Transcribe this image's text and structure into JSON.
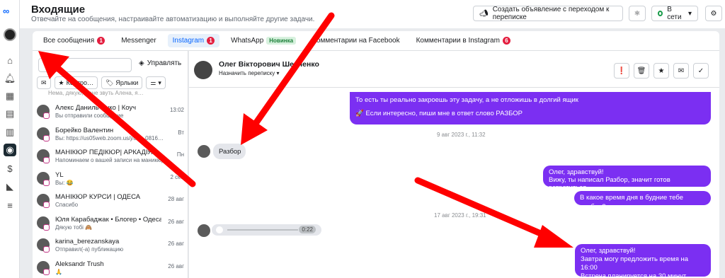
{
  "header": {
    "title": "Входящие",
    "subtitle": "Отвечайте на сообщения, настраивайте автоматизацию и выполняйте другие задачи.",
    "ad_button": "Создать объявление с переходом к переписке",
    "status_label": "В сети"
  },
  "tabs": [
    {
      "label": "Все сообщения",
      "badge": "1"
    },
    {
      "label": "Messenger",
      "badge": ""
    },
    {
      "label": "Instagram",
      "badge": "1"
    },
    {
      "label": "WhatsApp",
      "badge": "",
      "tag": "Новинка"
    },
    {
      "label": "Комментарии на Facebook",
      "badge": ""
    },
    {
      "label": "Комментарии в Instagram",
      "badge": "6"
    }
  ],
  "list": {
    "manage_label": "Управлять",
    "filters": [
      "Контро…",
      "Ярлыки"
    ],
    "clipped_preview": "Нема, дякую, мене звуть Алена, я…",
    "conversations": [
      {
        "name": "Алекс Данильченко | Коуч",
        "preview": "Вы отправили сообщение",
        "time": "13:02"
      },
      {
        "name": "Борейко Валентин",
        "preview": "Вы: https://us05web.zoom.us/j/85…0816…",
        "time": "Вт"
      },
      {
        "name": "МАНІКЮР ПЕДІКЮР| АРКАДІЯ",
        "preview": "Напоминаем о вашей записи на маникюр…",
        "time": "Пн"
      },
      {
        "name": "YL",
        "preview": "Вы: 😂",
        "time": "2 сен"
      },
      {
        "name": "МАНІКЮР КУРСИ | ОДЕСА",
        "preview": "Спасибо",
        "time": "28 авг"
      },
      {
        "name": "Юля Карабаджак • Блогер • Одеса",
        "preview": "Дякую тобі 🙈",
        "time": "26 авг"
      },
      {
        "name": "karina_berezanskaya",
        "preview": "Отправил(-а) публикацию",
        "time": "26 авг"
      },
      {
        "name": "Aleksandr Trush",
        "preview": "🙏",
        "time": "26 авг"
      }
    ]
  },
  "chat": {
    "contact_name": "Олег Вікторович Шевченко",
    "assign_label": "Назначить переписку ▾",
    "messages": {
      "m1_line1": "То есть ты реально закроешь эту задачу, а не отложишь в долгий ящик",
      "m1_line2": "🚀 Если интересно, пиши мне в ответ слово РАЗБОР",
      "ts1": "9 авг 2023 г., 11:32",
      "m2": "Разбор",
      "m3_line1": "Олег, здравствуй!",
      "m3_line2": "Вижу, ты написал Разбор, значит готов встретиться",
      "m4": "В какое время дня в будние тебе удобно?",
      "ts2": "17 авг 2023 г., 19:31",
      "audio_duration": "0:22",
      "m5_line1": "Олег, здравствуй!",
      "m5_line2": "Завтра могу предложить время на 16:00",
      "m5_line3": "Встреча планируется на 30 минут"
    }
  },
  "colors": {
    "accent": "#0866ff",
    "outgoing_bubble": "#7b2ff2",
    "badge": "#e41e3f",
    "arrow": "#ff0000"
  }
}
